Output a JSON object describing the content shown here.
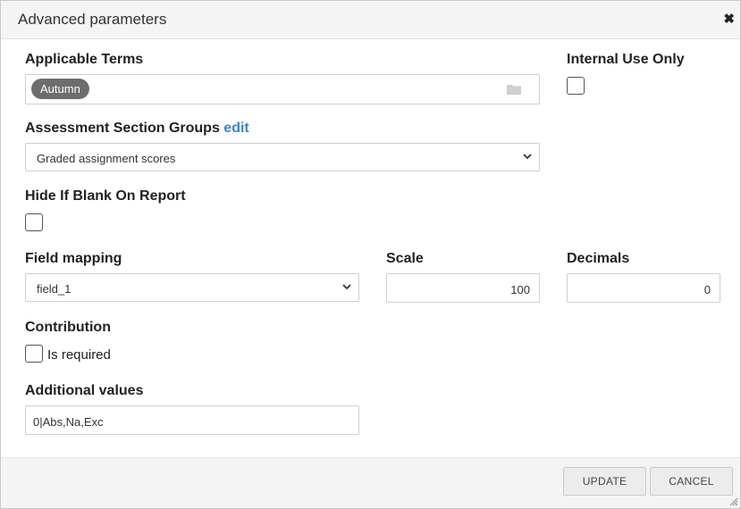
{
  "dialog": {
    "title": "Advanced parameters"
  },
  "applicable_terms": {
    "label": "Applicable Terms",
    "chips": [
      "Autumn"
    ]
  },
  "internal_use_only": {
    "label": "Internal Use Only",
    "checked": false
  },
  "assessment_section_groups": {
    "label": "Assessment Section Groups",
    "edit_link": "edit",
    "selected": "Graded assignment scores"
  },
  "hide_if_blank": {
    "label": "Hide If Blank On Report",
    "checked": false
  },
  "field_mapping": {
    "label": "Field mapping",
    "selected": "field_1"
  },
  "scale": {
    "label": "Scale",
    "value": "100"
  },
  "decimals": {
    "label": "Decimals",
    "value": "0"
  },
  "contribution": {
    "label": "Contribution",
    "is_required_label": "Is required",
    "checked": false
  },
  "additional_values": {
    "label": "Additional values",
    "value": "0|Abs,Na,Exc"
  },
  "buttons": {
    "update": "UPDATE",
    "cancel": "CANCEL"
  },
  "icons": {
    "close": "close-icon",
    "folder": "folder-icon",
    "dropdown": "chevron-down-icon",
    "resize": "resize-handle-icon"
  }
}
